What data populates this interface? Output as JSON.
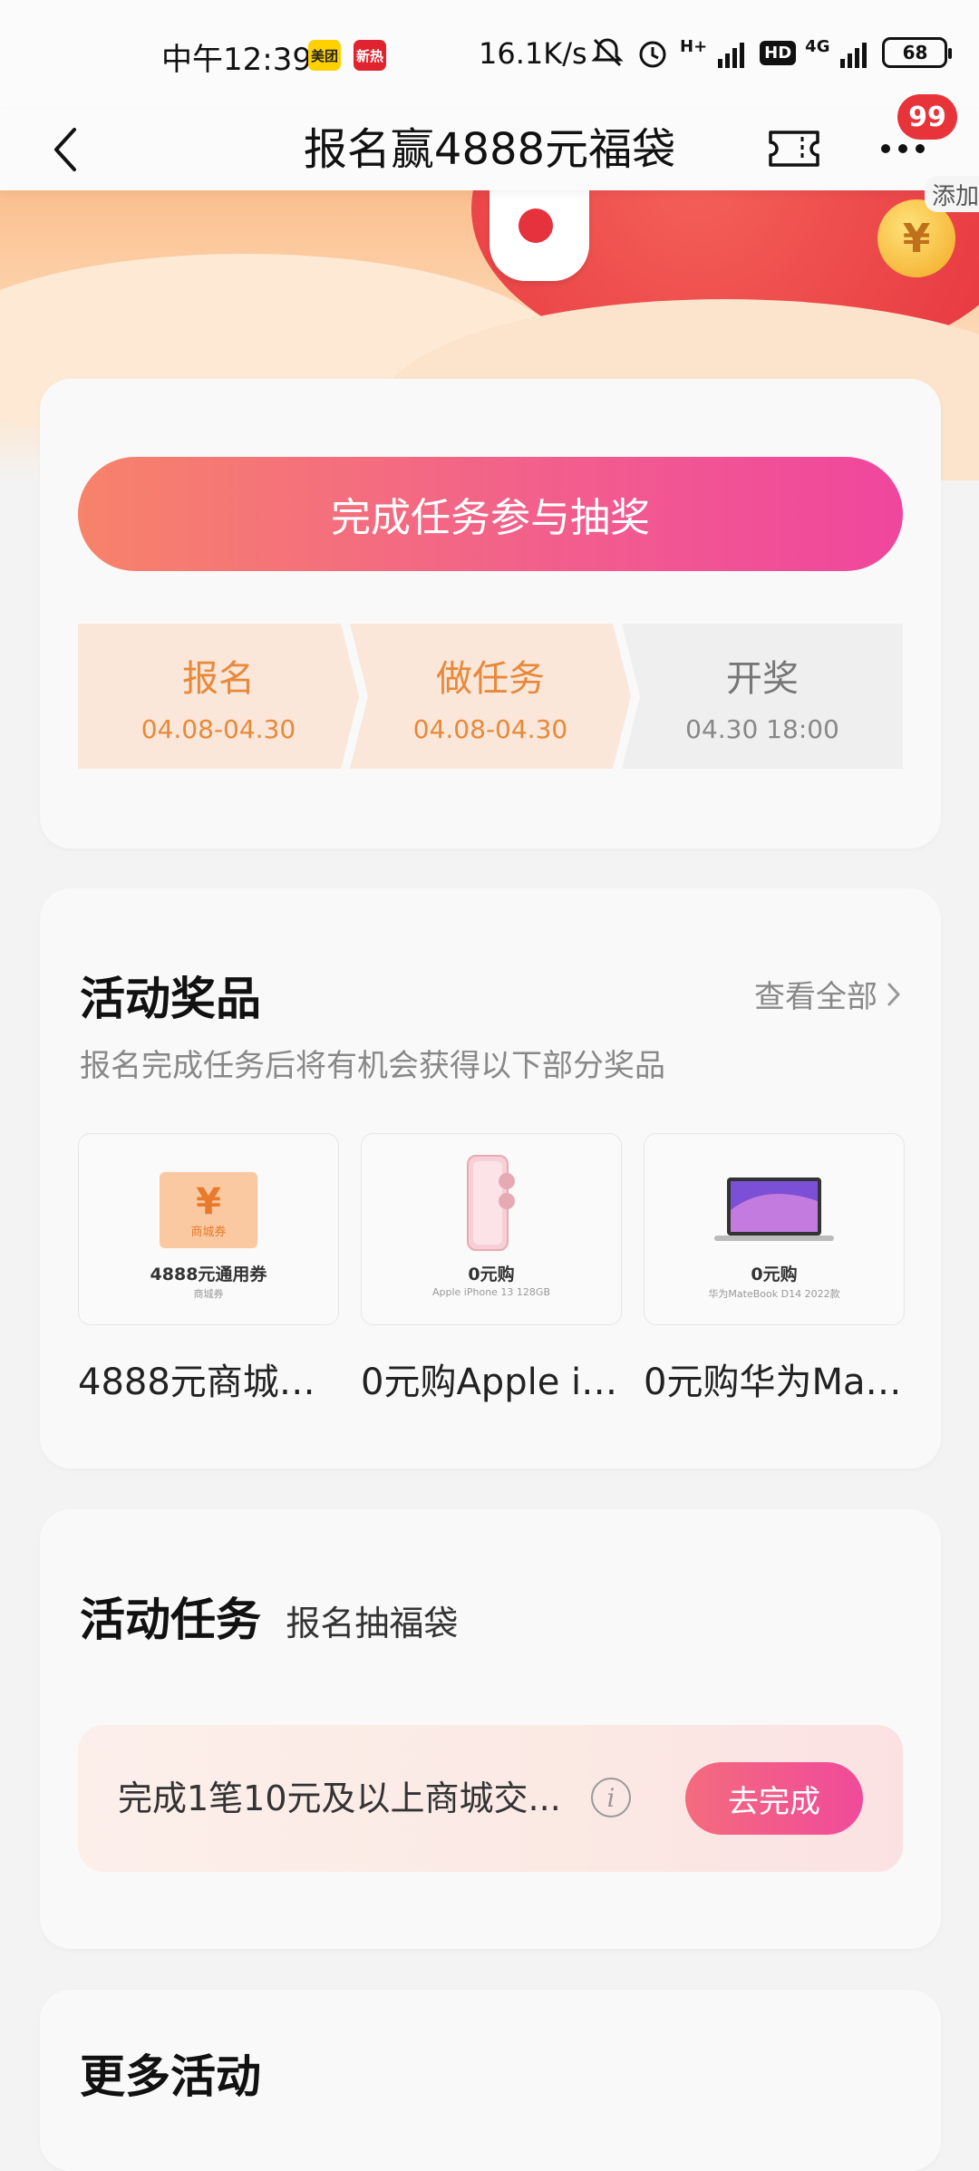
{
  "status_bar": {
    "time": "中午12:39",
    "app_icon_1": "美团",
    "app_icon_2": "新热",
    "net_speed": "16.1K/s",
    "network_type_1": "H+",
    "hd": "HD",
    "network_type_2": "4G",
    "battery": "68"
  },
  "nav": {
    "title": "报名赢4888元福袋",
    "badge": "99",
    "add_tag": "添加"
  },
  "signup": {
    "cta_label": "完成任务参与抽奖",
    "steps": [
      {
        "label": "报名",
        "date": "04.08-04.30"
      },
      {
        "label": "做任务",
        "date": "04.08-04.30"
      },
      {
        "label": "开奖",
        "date": "04.30 18:00"
      }
    ]
  },
  "prizes": {
    "title": "活动奖品",
    "view_all": "查看全部",
    "subtitle": "报名完成任务后将有机会获得以下部分奖品",
    "items": [
      {
        "img_main": "4888元通用券",
        "img_sub": "商城券",
        "coupon_text": "商城券",
        "name": "4888元商城券..."
      },
      {
        "img_main": "0元购",
        "img_sub": "Apple iPhone 13 128GB",
        "name": "0元购Apple iP..."
      },
      {
        "img_main": "0元购",
        "img_sub": "华为MateBook D14 2022款",
        "name": "0元购华为Mat..."
      }
    ]
  },
  "tasks": {
    "title": "活动任务",
    "subtitle": "报名抽福袋",
    "item_text": "完成1笔10元及以上商城交...",
    "info": "i",
    "button": "去完成"
  },
  "more": {
    "title": "更多活动"
  }
}
